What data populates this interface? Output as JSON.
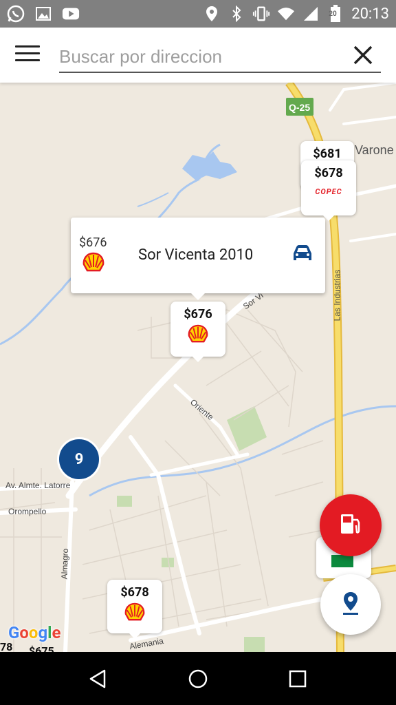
{
  "status_bar": {
    "time": "20:13",
    "battery_level": "20",
    "left_icons": [
      "whatsapp-icon",
      "image-icon",
      "youtube-icon"
    ],
    "right_icons": [
      "location-icon",
      "bluetooth-icon",
      "vibrate-icon",
      "wifi-icon",
      "signal-icon",
      "battery-icon"
    ]
  },
  "search": {
    "placeholder": "Buscar por direccion",
    "value": ""
  },
  "map": {
    "road_labels": {
      "q25": "Q-25",
      "varone": "Varone",
      "las_industrias": "Las Industrias",
      "sor_vi": "Sor Vi",
      "oriente": "Oriente",
      "almte_latorre": "Av. Almte. Latorre",
      "orompello": "Orompello",
      "almagro": "Almagro",
      "alemania": "Alemania"
    },
    "google": "Google",
    "partial_prices": [
      "78",
      "$675"
    ]
  },
  "markers": [
    {
      "price": "$681",
      "brand": "copec"
    },
    {
      "price": "$678",
      "brand": "copec",
      "brand_text": "COPEC"
    },
    {
      "price": "$676",
      "brand": "shell"
    },
    {
      "price": "$678",
      "brand": "shell"
    }
  ],
  "info_card": {
    "price": "$676",
    "brand": "shell",
    "address": "Sor Vicenta 2010"
  },
  "cluster": {
    "count": "9"
  },
  "colors": {
    "accent_red": "#e31b23",
    "cluster_blue": "#124b8d",
    "highway_yellow": "#f1cd47"
  }
}
